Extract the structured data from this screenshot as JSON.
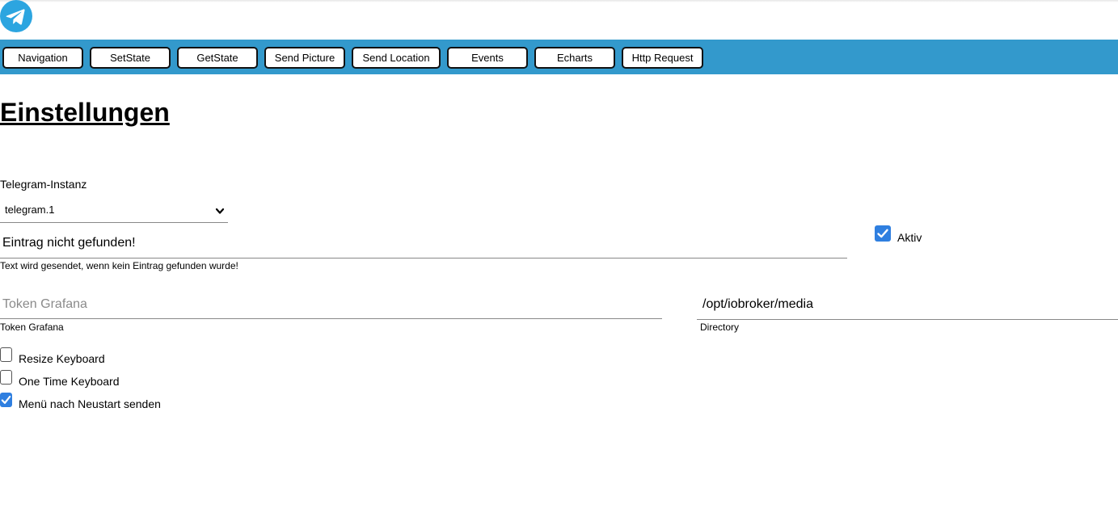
{
  "app": {
    "logo_icon": "telegram-logo-icon",
    "accent_color": "#3399cc"
  },
  "nav": {
    "items": [
      {
        "label": "Navigation"
      },
      {
        "label": "SetState"
      },
      {
        "label": "GetState"
      },
      {
        "label": "Send Picture"
      },
      {
        "label": "Send Location"
      },
      {
        "label": "Events"
      },
      {
        "label": "Echarts"
      },
      {
        "label": "Http Request"
      }
    ]
  },
  "page": {
    "title": "Einstellungen"
  },
  "instance": {
    "label": "Telegram-Instanz",
    "selected": "telegram.1"
  },
  "not_found": {
    "value": "Eintrag nicht gefunden!",
    "helper": "Text wird gesendet, wenn kein Eintrag gefunden wurde!"
  },
  "aktiv": {
    "label": "Aktiv",
    "checked": true
  },
  "token": {
    "placeholder": "Token Grafana",
    "helper": "Token Grafana"
  },
  "directory": {
    "value": "/opt/iobroker/media",
    "helper": "Directory"
  },
  "options": [
    {
      "label": "Resize Keyboard",
      "checked": false
    },
    {
      "label": "One Time Keyboard",
      "checked": false
    },
    {
      "label": "Menü nach Neustart senden",
      "checked": true
    }
  ]
}
